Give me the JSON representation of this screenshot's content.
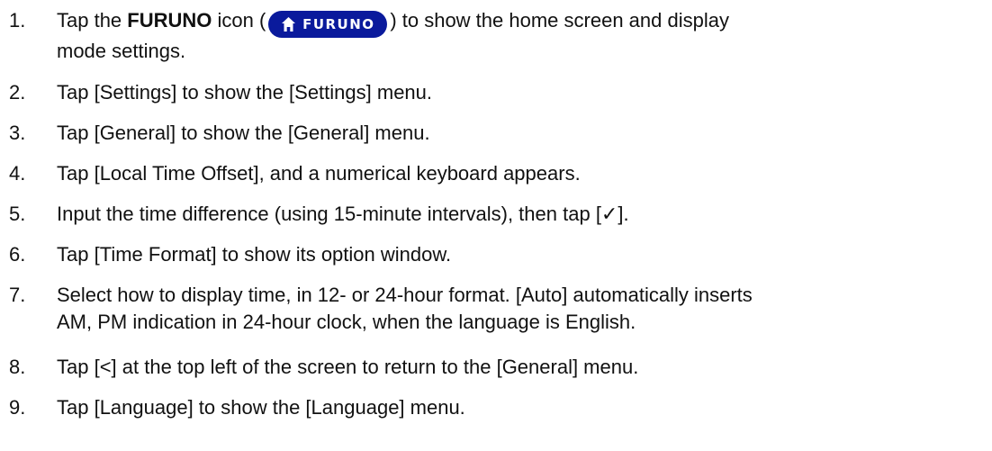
{
  "steps": [
    {
      "number": "1.",
      "prefix": "Tap the ",
      "bold": "FURUNO",
      "mid": " icon (",
      "icon": {
        "name": "furuno-home-icon",
        "label": "FURUNO",
        "color": "#0a1a9c"
      },
      "after": ") to show the home screen and display",
      "line2": "mode settings."
    },
    {
      "number": "2.",
      "text": "Tap [Settings] to show the [Settings] menu."
    },
    {
      "number": "3.",
      "text": "Tap [General] to show the [General] menu."
    },
    {
      "number": "4.",
      "text": "Tap [Local Time Offset], and a numerical keyboard appears."
    },
    {
      "number": "5.",
      "text": "Input the time difference (using 15-minute intervals), then tap [✓]."
    },
    {
      "number": "6.",
      "text": "Tap [Time Format] to show its option window."
    },
    {
      "number": "7.",
      "text": "Select how to display time, in 12- or 24-hour format. [Auto] automatically inserts",
      "line2": "AM, PM indication in 24-hour clock, when the language is English."
    },
    {
      "number": "8.",
      "text": "Tap [<] at the top left of the screen to return to the [General] menu."
    },
    {
      "number": "9.",
      "text": "Tap [Language] to show the [Language] menu."
    }
  ]
}
